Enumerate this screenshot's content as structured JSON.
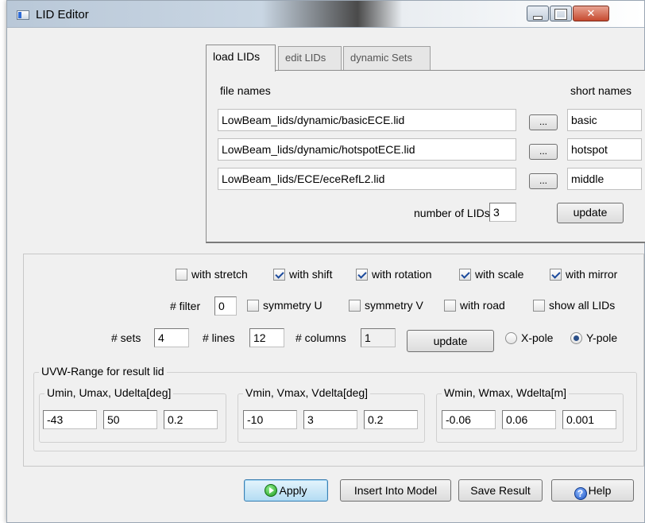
{
  "window": {
    "title": "LID Editor"
  },
  "tabs": [
    {
      "label": "load LIDs",
      "active": true
    },
    {
      "label": "edit LIDs",
      "active": false
    },
    {
      "label": "dynamic Sets",
      "active": false
    }
  ],
  "load": {
    "file_names_label": "file names",
    "short_names_label": "short names",
    "files": [
      {
        "path": "LowBeam_lids/dynamic/basicECE.lid",
        "browse": "...",
        "short": "basic"
      },
      {
        "path": "LowBeam_lids/dynamic/hotspotECE.lid",
        "browse": "...",
        "short": "hotspot"
      },
      {
        "path": "LowBeam_lids/ECE/eceRefL2.lid",
        "browse": "...",
        "short": "middle"
      }
    ],
    "num_lids_label": "number of LIDs",
    "num_lids_value": "3",
    "update_label": "update"
  },
  "options": {
    "checkboxes_row1": [
      {
        "label": "with stretch",
        "checked": false
      },
      {
        "label": "with shift",
        "checked": true
      },
      {
        "label": "with rotation",
        "checked": true
      },
      {
        "label": "with scale",
        "checked": true
      },
      {
        "label": "with mirror",
        "checked": true
      }
    ],
    "filter_label": "# filter",
    "filter_value": "0",
    "checkboxes_row2": [
      {
        "label": "symmetry U",
        "checked": false
      },
      {
        "label": "symmetry V",
        "checked": false
      },
      {
        "label": "with road",
        "checked": false
      },
      {
        "label": "show all LIDs",
        "checked": false
      }
    ],
    "sets_label": "# sets",
    "sets_value": "4",
    "lines_label": "# lines",
    "lines_value": "12",
    "columns_label": "# columns",
    "columns_value": "1",
    "update_label": "update",
    "xpole_label": "X-pole",
    "ypole_label": "Y-pole",
    "pole_selected": "Y-pole"
  },
  "uvw": {
    "title": "UVW-Range for result lid",
    "u": {
      "label": "Umin, Umax, Udelta[deg]",
      "min": "-43",
      "max": "50",
      "delta": "0.2"
    },
    "v": {
      "label": "Vmin, Vmax, Vdelta[deg]",
      "min": "-10",
      "max": "3",
      "delta": "0.2"
    },
    "w": {
      "label": "Wmin, Wmax, Wdelta[m]",
      "min": "-0.06",
      "max": "0.06",
      "delta": "0.001"
    }
  },
  "footer": {
    "apply": "Apply",
    "insert": "Insert Into Model",
    "save": "Save Result",
    "help": "Help"
  }
}
